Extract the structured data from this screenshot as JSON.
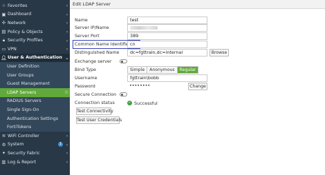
{
  "sidebar": {
    "items": [
      {
        "label": "Favorites",
        "icon": "star-icon",
        "chevron": "›"
      },
      {
        "label": "Dashboard",
        "icon": "dashboard-icon",
        "chevron": "›"
      },
      {
        "label": "Network",
        "icon": "network-icon",
        "chevron": "›"
      },
      {
        "label": "Policy & Objects",
        "icon": "policy-icon",
        "chevron": "›"
      },
      {
        "label": "Security Profiles",
        "icon": "lock-icon",
        "chevron": "›"
      },
      {
        "label": "VPN",
        "icon": "vpn-icon",
        "chevron": "›"
      },
      {
        "label": "User & Authentication",
        "icon": "user-icon",
        "chevron": "⌄"
      },
      {
        "label": "User Definition"
      },
      {
        "label": "User Groups"
      },
      {
        "label": "Guest Management"
      },
      {
        "label": "LDAP Servers",
        "star": "☆"
      },
      {
        "label": "RADIUS Servers"
      },
      {
        "label": "Single Sign-On"
      },
      {
        "label": "Authentication Settings"
      },
      {
        "label": "FortiTokens"
      },
      {
        "label": "WiFi Controller",
        "icon": "wifi-icon",
        "chevron": "›"
      },
      {
        "label": "System",
        "icon": "gear-icon",
        "chevron": "›",
        "badge": "1"
      },
      {
        "label": "Security Fabric",
        "icon": "fabric-icon",
        "chevron": "›"
      },
      {
        "label": "Log & Report",
        "icon": "log-icon",
        "chevron": "›"
      }
    ]
  },
  "panel": {
    "title": "Edit LDAP Server"
  },
  "form": {
    "name_label": "Name",
    "name_value": "test",
    "server_ip_label": "Server IP/Name",
    "server_port_label": "Server Port",
    "server_port_value": "389",
    "cn_label": "Common Name Identifier",
    "cn_value": "cn",
    "dn_label": "Distinguished Name",
    "dn_value": "dc=fgttrain,dc=internal",
    "browse_label": "Browse",
    "exchange_label": "Exchange server",
    "bind_type_label": "Bind Type",
    "bind_options": [
      "Simple",
      "Anonymous",
      "Regular"
    ],
    "username_label": "Username",
    "username_value": "fgttrain\\bobb",
    "password_label": "Password",
    "password_value": "••••••••",
    "change_label": "Change",
    "secure_label": "Secure Connection",
    "conn_status_label": "Connection status",
    "conn_status_value": "Successful",
    "test_conn_label": "Test Connectivity",
    "test_creds_label": "Test User Credentials"
  },
  "colors": {
    "sidebar_bg": "#283847",
    "active_green": "#61a93b",
    "highlight_blue": "#2f3fb7"
  }
}
